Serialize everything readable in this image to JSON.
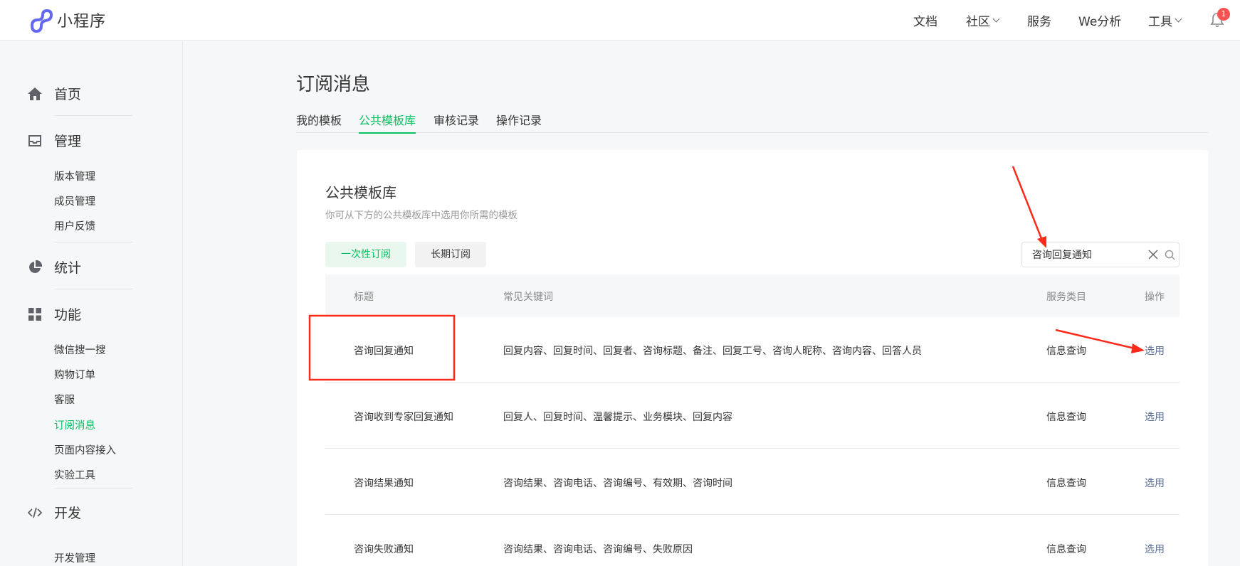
{
  "app": {
    "logo_text": "小程序",
    "brand_color": "#07c160",
    "link_color": "#576b95"
  },
  "topnav": {
    "items": [
      {
        "label": "文档",
        "has_dropdown": false
      },
      {
        "label": "社区",
        "has_dropdown": true
      },
      {
        "label": "服务",
        "has_dropdown": false
      },
      {
        "label": "We分析",
        "has_dropdown": false
      },
      {
        "label": "工具",
        "has_dropdown": true
      }
    ],
    "notification_count": "1"
  },
  "sidebar": {
    "groups": [
      {
        "label": "首页",
        "icon": "home-icon",
        "items": []
      },
      {
        "label": "管理",
        "icon": "inbox-icon",
        "items": [
          "版本管理",
          "成员管理",
          "用户反馈"
        ]
      },
      {
        "label": "统计",
        "icon": "pie-chart-icon",
        "items": []
      },
      {
        "label": "功能",
        "icon": "grid-icon",
        "items": [
          "微信搜一搜",
          "购物订单",
          "客服",
          "订阅消息",
          "页面内容接入",
          "实验工具"
        ]
      },
      {
        "label": "开发",
        "icon": "code-icon",
        "items": [
          "开发管理"
        ]
      }
    ],
    "active_item": "订阅消息"
  },
  "main": {
    "title": "订阅消息",
    "tabs": [
      "我的模板",
      "公共模板库",
      "审核记录",
      "操作记录"
    ],
    "active_tab": "公共模板库",
    "card": {
      "title": "公共模板库",
      "description": "你可从下方的公共模板库中选用你所需的模板",
      "filters": [
        "一次性订阅",
        "长期订阅"
      ],
      "active_filter": "一次性订阅",
      "search": {
        "value": "咨询回复通知",
        "placeholder": ""
      },
      "table": {
        "columns": [
          "标题",
          "常见关键词",
          "服务类目",
          "操作"
        ],
        "rows": [
          {
            "title": "咨询回复通知",
            "keywords": "回复内容、回复时间、回复者、咨询标题、备注、回复工号、咨询人昵称、咨询内容、回答人员",
            "category": "信息查询",
            "action": "选用"
          },
          {
            "title": "咨询收到专家回复通知",
            "keywords": "回复人、回复时间、温馨提示、业务模块、回复内容",
            "category": "信息查询",
            "action": "选用"
          },
          {
            "title": "咨询结果通知",
            "keywords": "咨询结果、咨询电话、咨询编号、有效期、咨询时间",
            "category": "信息查询",
            "action": "选用"
          },
          {
            "title": "咨询失败通知",
            "keywords": "咨询结果、咨询电话、咨询编号、失败原因",
            "category": "信息查询",
            "action": "选用"
          }
        ]
      }
    }
  },
  "annotations": {
    "color": "#ff2a1a"
  }
}
